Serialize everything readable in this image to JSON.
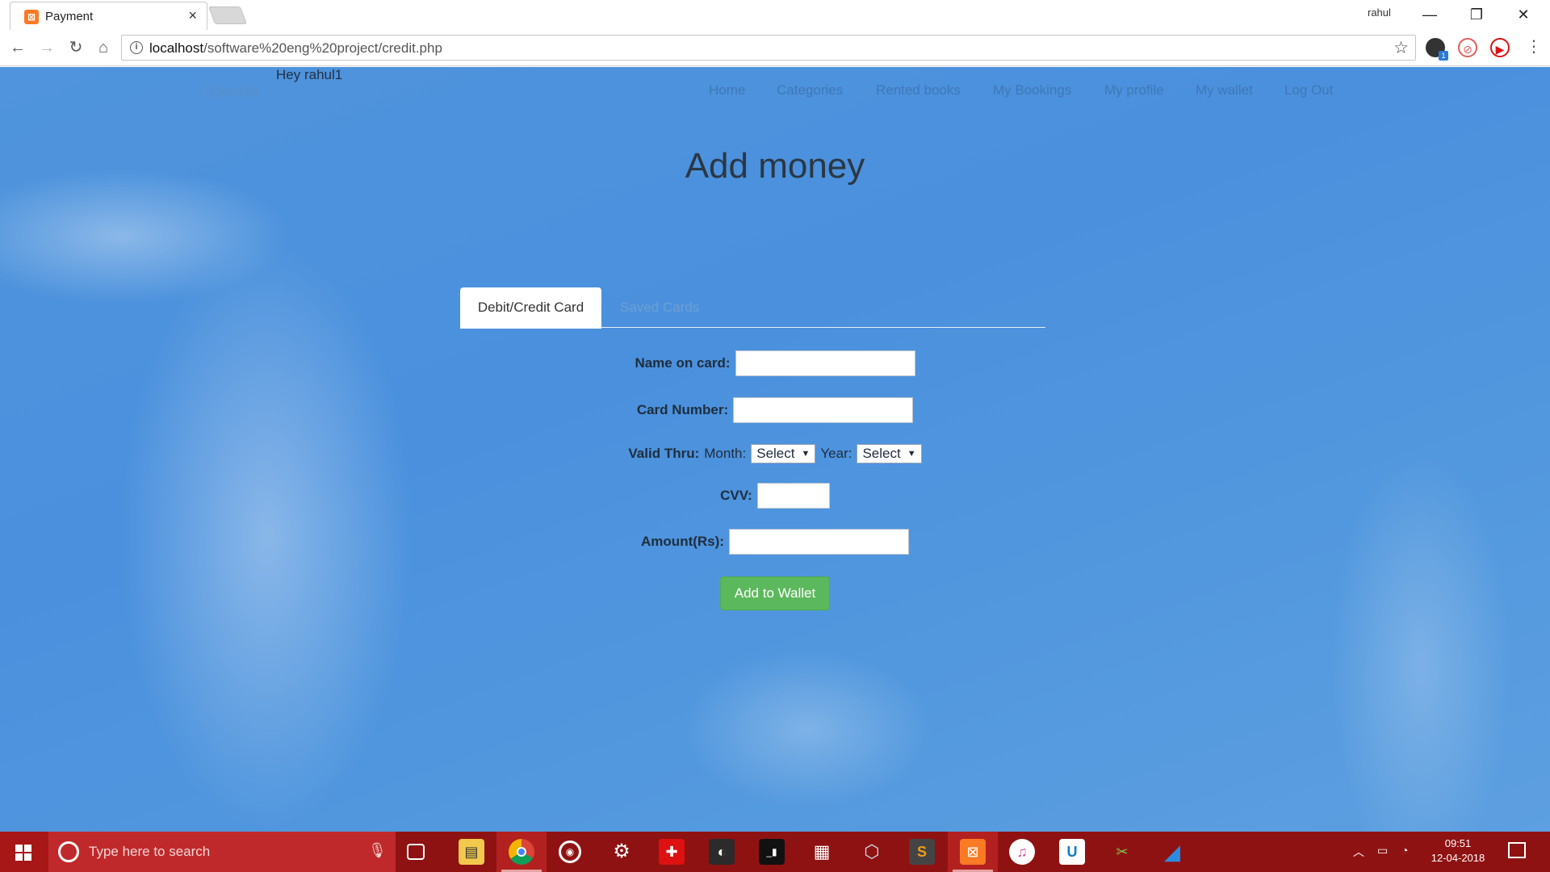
{
  "browser": {
    "tab_title": "Payment",
    "tab_close": "×",
    "profile_name": "rahul",
    "window_controls": {
      "minimize": "—",
      "restore": "❐",
      "close": "✕"
    },
    "url_host": "localhost",
    "url_path": "/software%20eng%20project/credit.php",
    "back": "←",
    "forward": "→",
    "reload": "↻",
    "home": "⌂",
    "bookmark_star": "☆",
    "menu": "⋮",
    "extension_badge": "1"
  },
  "site": {
    "brand": "Libraria",
    "greeting": "Hey rahul1",
    "nav": [
      "Home",
      "Categories",
      "Rented books",
      "My Bookings",
      "My profile",
      "My wallet",
      "Log Out"
    ]
  },
  "main": {
    "heading": "Add money",
    "tabs": {
      "active": "Debit/Credit Card",
      "inactive": "Saved Cards"
    },
    "form": {
      "name_label": "Name on card:",
      "card_label": "Card Number:",
      "valid_label": "Valid Thru:",
      "month_label": "Month:",
      "month_value": "Select",
      "year_label": "Year:",
      "year_value": "Select",
      "cvv_label": "CVV:",
      "amount_label": "Amount(Rs):",
      "submit_label": "Add to Wallet"
    }
  },
  "taskbar": {
    "search_placeholder": "Type here to search",
    "time": "09:51",
    "date": "12-04-2018",
    "pinned_icons": [
      "task-view-icon",
      "file-explorer-icon",
      "chrome-icon",
      "groove-icon",
      "settings-icon",
      "security-icon",
      "steam-icon",
      "terminal-icon",
      "calculator-icon",
      "virtualbox-icon",
      "sublime-icon",
      "xampp-icon",
      "itunes-icon",
      "unikey-icon",
      "tool-icon",
      "shark-icon"
    ]
  },
  "colors": {
    "sky_background": "#4a90dd",
    "taskbar": "#8f1212",
    "button_green": "#5cb85c",
    "nav_text": "#3f78b6"
  }
}
